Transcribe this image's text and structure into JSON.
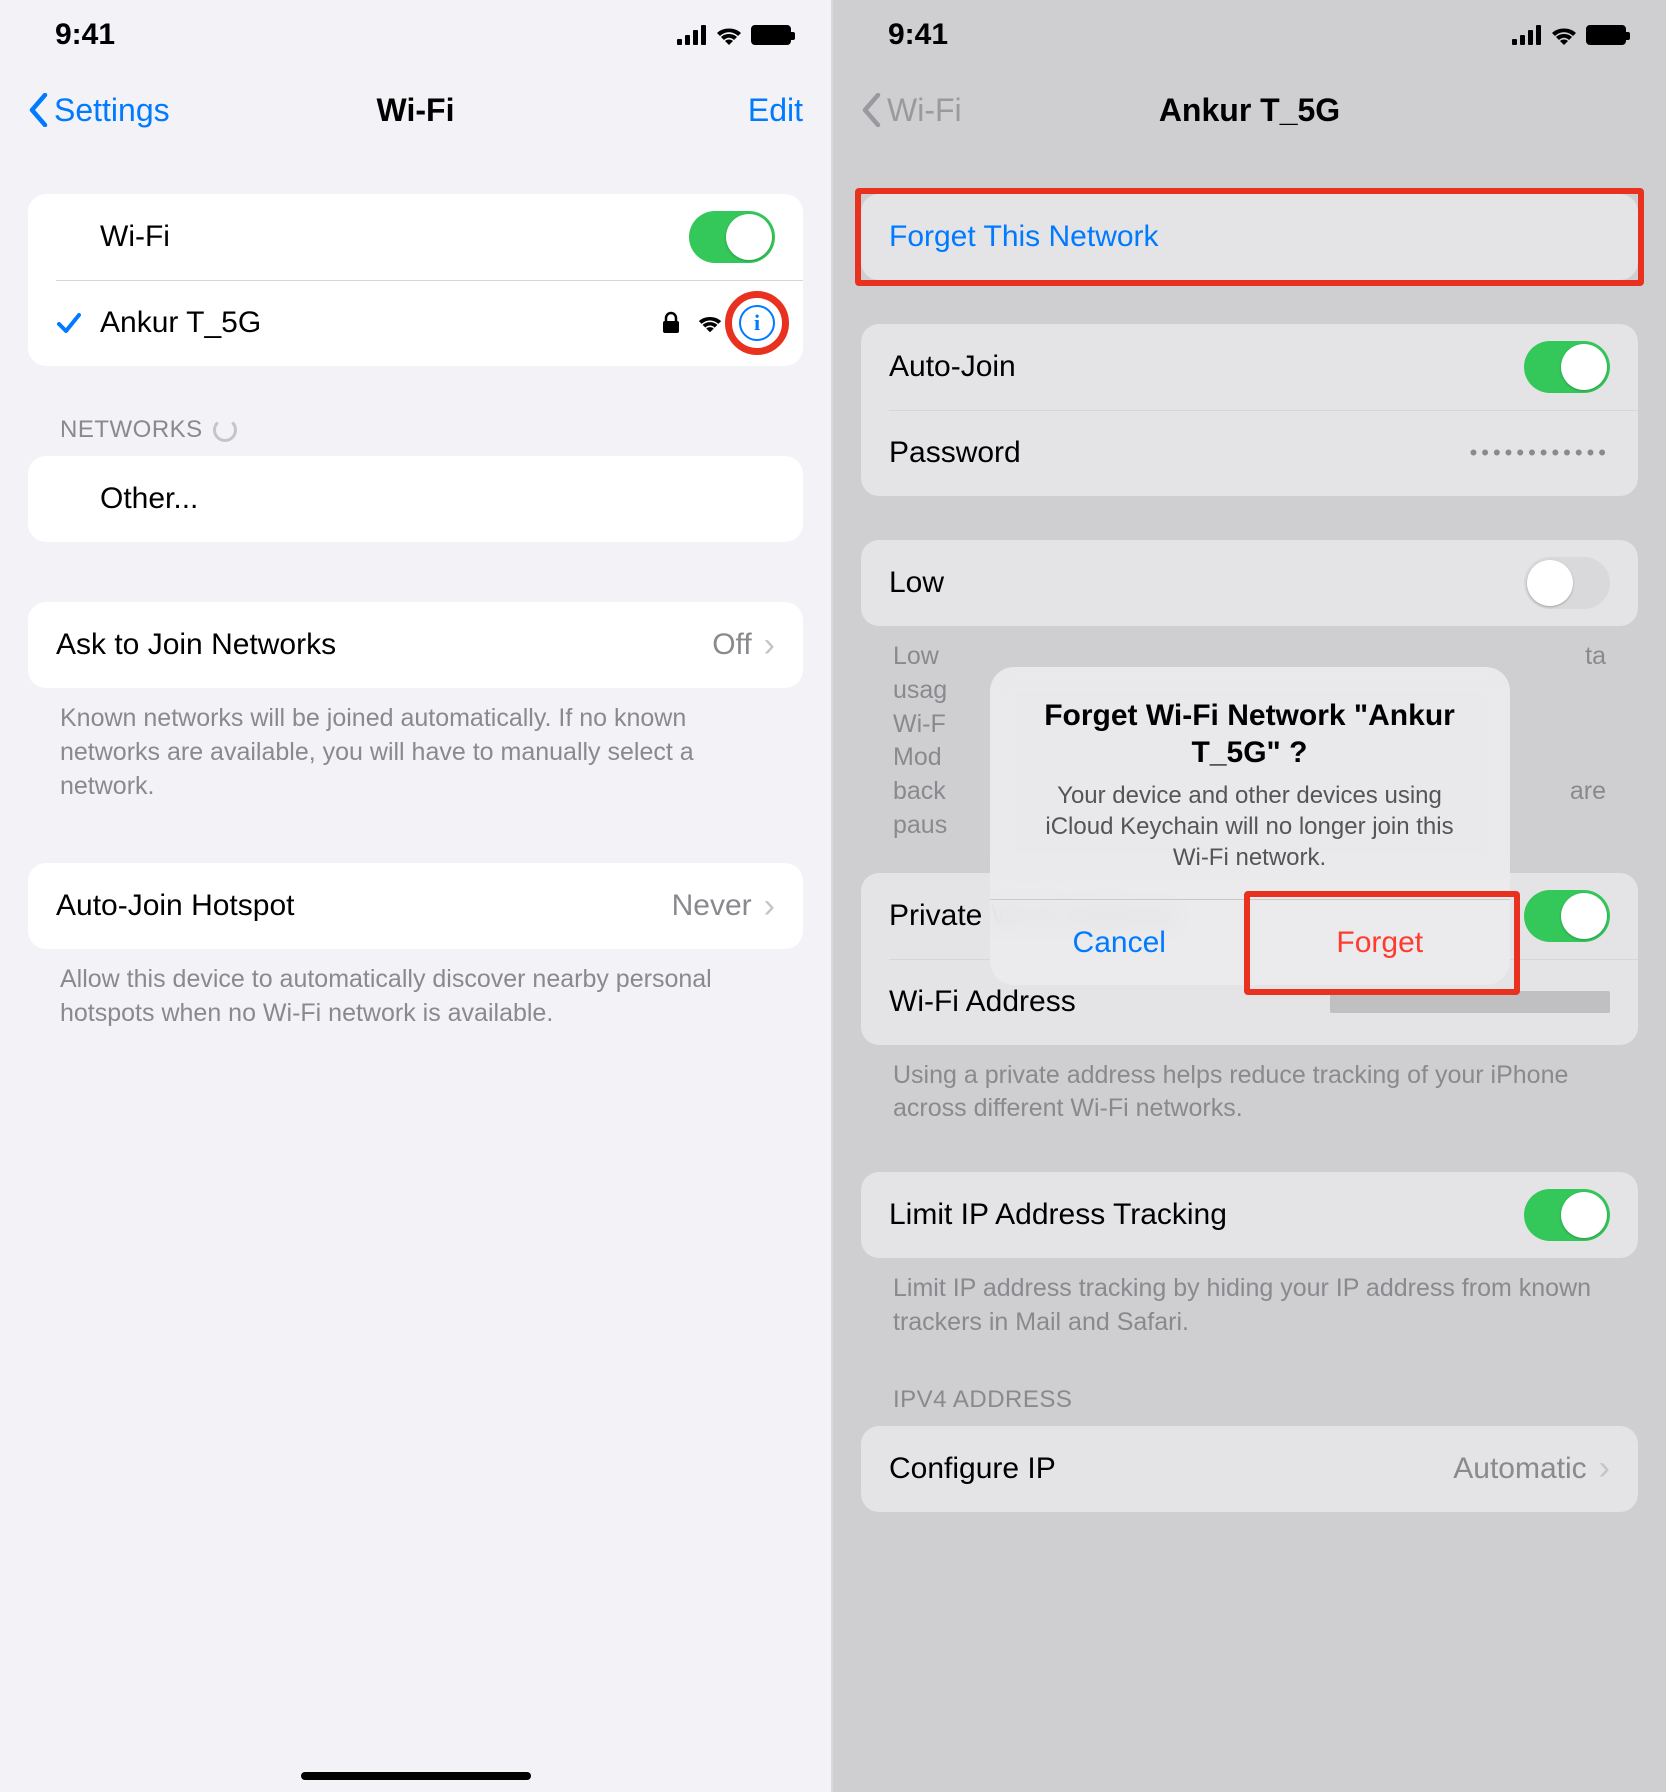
{
  "statusBar": {
    "time": "9:41"
  },
  "left": {
    "nav": {
      "back": "Settings",
      "title": "Wi-Fi",
      "edit": "Edit"
    },
    "wifiToggleLabel": "Wi-Fi",
    "connectedNetwork": "Ankur T_5G",
    "networksHeader": "NETWORKS",
    "other": "Other...",
    "askToJoin": {
      "label": "Ask to Join Networks",
      "value": "Off"
    },
    "askFooter": "Known networks will be joined automatically. If no known networks are available, you will have to manually select a network.",
    "autoJoinHotspot": {
      "label": "Auto-Join Hotspot",
      "value": "Never"
    },
    "hotspotFooter": "Allow this device to automatically discover nearby personal hotspots when no Wi-Fi network is available."
  },
  "right": {
    "nav": {
      "back": "Wi-Fi",
      "title": "Ankur T_5G"
    },
    "forget": "Forget This Network",
    "autoJoin": "Auto-Join",
    "password": "Password",
    "passwordDots": "••••••••••••",
    "lowDataLabel": "Low",
    "lowFooter": "Low Data Mode helps reduce your iPhone data usage over your cellular network or specific Wi-Fi networks you select. When Low Data Mode is turned on, automatic updates and background tasks, such as Photos syncing, are paused.",
    "lowFooterVisibleStart": "Low",
    "lowFooterLine1End": "ta",
    "lowFooterLine2Start": "usag",
    "lowFooterLine3Start": "Wi-F",
    "lowFooterLine4Start": "Mod",
    "lowFooterLine5Start": "back",
    "lowFooterLine5End": "are",
    "lowFooterLine6Start": "paus",
    "privateAddress": "Private Wi-Fi Address",
    "wifiAddress": "Wi-Fi Address",
    "privateFooter": "Using a private address helps reduce tracking of your iPhone across different Wi-Fi networks.",
    "limitTracking": "Limit IP Address Tracking",
    "limitFooter": "Limit IP address tracking by hiding your IP address from known trackers in Mail and Safari.",
    "ipv4Header": "IPV4 ADDRESS",
    "configureIP": {
      "label": "Configure IP",
      "value": "Automatic"
    },
    "alert": {
      "title": "Forget Wi-Fi Network \"Ankur T_5G\" ?",
      "message": "Your device and other devices using iCloud Keychain will no longer join this Wi-Fi network.",
      "cancel": "Cancel",
      "forget": "Forget"
    }
  }
}
